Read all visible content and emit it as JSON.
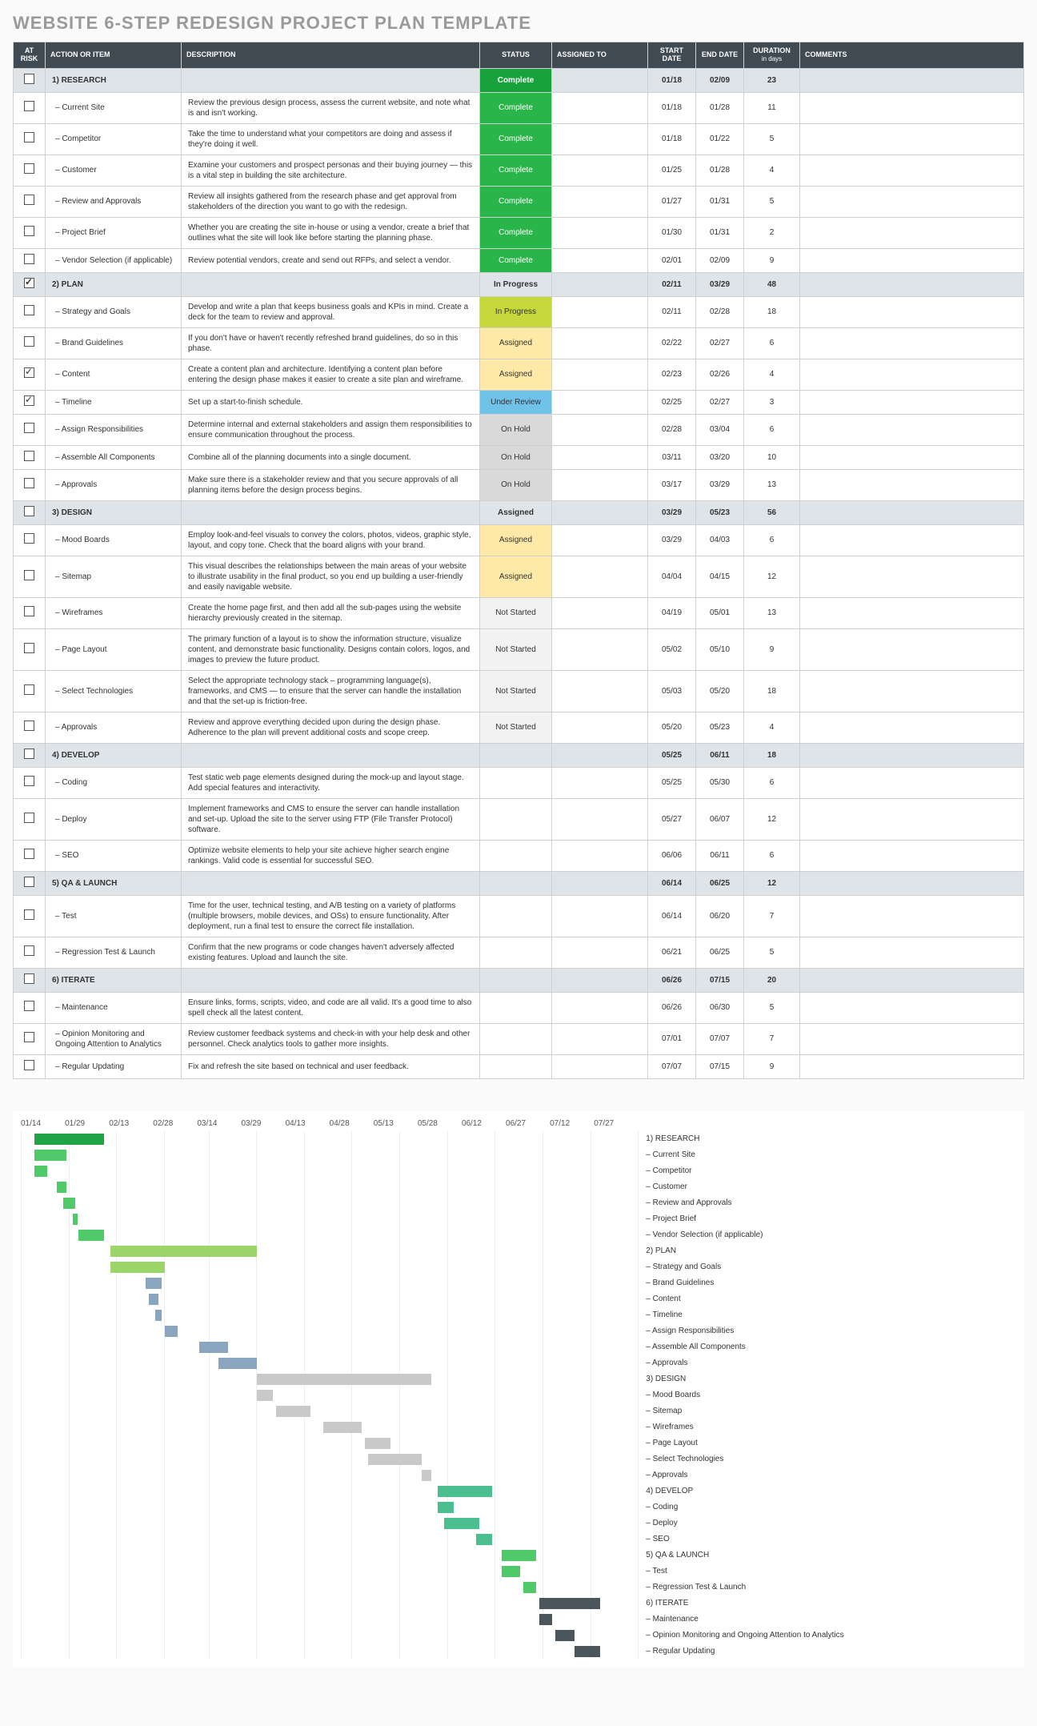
{
  "title": "WEBSITE 6-STEP REDESIGN PROJECT PLAN TEMPLATE",
  "headers": {
    "risk": "AT RISK",
    "action": "ACTION OR ITEM",
    "desc": "DESCRIPTION",
    "status": "STATUS",
    "assigned": "ASSIGNED TO",
    "start": "START DATE",
    "end": "END DATE",
    "duration": "DURATION",
    "duration_unit": "in days",
    "comments": "COMMENTS"
  },
  "rows": [
    {
      "phase": true,
      "chk": false,
      "action": "1) RESEARCH",
      "desc": "",
      "status": "Complete",
      "start": "01/18",
      "end": "02/09",
      "dur": "23"
    },
    {
      "chk": false,
      "action": "– Current Site",
      "desc": "Review the previous design process, assess the current website, and note what is and isn't working.",
      "status": "Complete",
      "start": "01/18",
      "end": "01/28",
      "dur": "11"
    },
    {
      "chk": false,
      "action": "– Competitor",
      "desc": "Take the time to understand what your competitors are doing and assess if they're doing it well.",
      "status": "Complete",
      "start": "01/18",
      "end": "01/22",
      "dur": "5"
    },
    {
      "chk": false,
      "action": "– Customer",
      "desc": "Examine your customers and prospect personas and their buying journey — this is a vital step in building the site architecture.",
      "status": "Complete",
      "start": "01/25",
      "end": "01/28",
      "dur": "4"
    },
    {
      "chk": false,
      "action": "– Review and Approvals",
      "desc": "Review all insights gathered from the research phase and get approval from stakeholders of the direction you want to go with the redesign.",
      "status": "Complete",
      "start": "01/27",
      "end": "01/31",
      "dur": "5"
    },
    {
      "chk": false,
      "action": "– Project Brief",
      "desc": "Whether you are creating the site in-house or using a vendor, create a brief that outlines what the site will look like before starting the planning phase.",
      "status": "Complete",
      "start": "01/30",
      "end": "01/31",
      "dur": "2"
    },
    {
      "chk": false,
      "action": "– Vendor Selection (if applicable)",
      "desc": "Review potential vendors, create and send out RFPs, and select a vendor.",
      "status": "Complete",
      "start": "02/01",
      "end": "02/09",
      "dur": "9"
    },
    {
      "phase": true,
      "chk": true,
      "action": "2) PLAN",
      "desc": "",
      "status": "In Progress",
      "start": "02/11",
      "end": "03/29",
      "dur": "48"
    },
    {
      "chk": false,
      "action": "– Strategy and Goals",
      "desc": "Develop and write a plan that keeps business goals and KPIs in mind. Create a deck for the team to review and approval.",
      "status": "In Progress",
      "start": "02/11",
      "end": "02/28",
      "dur": "18"
    },
    {
      "chk": false,
      "action": "– Brand Guidelines",
      "desc": "If you don't have or haven't recently refreshed brand guidelines, do so in this phase.",
      "status": "Assigned",
      "start": "02/22",
      "end": "02/27",
      "dur": "6"
    },
    {
      "chk": true,
      "action": "– Content",
      "desc": "Create a content plan and architecture. Identifying a content plan before entering the design phase makes it easier to create a site plan and wireframe.",
      "status": "Assigned",
      "start": "02/23",
      "end": "02/26",
      "dur": "4"
    },
    {
      "chk": true,
      "action": "– Timeline",
      "desc": "Set up a start-to-finish schedule.",
      "status": "Under Review",
      "start": "02/25",
      "end": "02/27",
      "dur": "3"
    },
    {
      "chk": false,
      "action": "– Assign Responsibilities",
      "desc": "Determine internal and external stakeholders and assign them responsibilities to ensure communication throughout the process.",
      "status": "On Hold",
      "start": "02/28",
      "end": "03/04",
      "dur": "6"
    },
    {
      "chk": false,
      "action": "– Assemble All Components",
      "desc": "Combine all of the planning documents into a single document.",
      "status": "On Hold",
      "start": "03/11",
      "end": "03/20",
      "dur": "10"
    },
    {
      "chk": false,
      "action": "– Approvals",
      "desc": "Make sure there is a stakeholder review and that you secure approvals of all planning items before the design process begins.",
      "status": "On Hold",
      "start": "03/17",
      "end": "03/29",
      "dur": "13"
    },
    {
      "phase": true,
      "chk": false,
      "action": "3) DESIGN",
      "desc": "",
      "status": "Assigned",
      "start": "03/29",
      "end": "05/23",
      "dur": "56"
    },
    {
      "chk": false,
      "action": "– Mood Boards",
      "desc": "Employ look-and-feel visuals to convey the colors, photos, videos, graphic style, layout, and copy tone. Check that the board aligns with your brand.",
      "status": "Assigned",
      "start": "03/29",
      "end": "04/03",
      "dur": "6"
    },
    {
      "chk": false,
      "action": "– Sitemap",
      "desc": "This visual describes the relationships between the main areas of your website to illustrate usability in the final product, so you end up building a user-friendly and easily navigable website.",
      "status": "Assigned",
      "start": "04/04",
      "end": "04/15",
      "dur": "12"
    },
    {
      "chk": false,
      "action": "– Wireframes",
      "desc": "Create the home page first, and then add all the sub-pages using the website hierarchy previously created in the sitemap.",
      "status": "Not Started",
      "start": "04/19",
      "end": "05/01",
      "dur": "13"
    },
    {
      "chk": false,
      "action": "– Page Layout",
      "desc": "The primary function of a layout is to show the information structure, visualize content, and demonstrate basic functionality. Designs contain colors, logos, and images to preview the future product.",
      "status": "Not Started",
      "start": "05/02",
      "end": "05/10",
      "dur": "9"
    },
    {
      "chk": false,
      "action": "– Select Technologies",
      "desc": "Select the appropriate technology stack – programming language(s), frameworks, and CMS — to ensure that the server can handle the installation and that the set-up is friction-free.",
      "status": "Not Started",
      "start": "05/03",
      "end": "05/20",
      "dur": "18"
    },
    {
      "chk": false,
      "action": "– Approvals",
      "desc": "Review and approve everything decided upon during the design phase. Adherence to the plan will prevent additional costs and scope creep.",
      "status": "Not Started",
      "start": "05/20",
      "end": "05/23",
      "dur": "4"
    },
    {
      "phase": true,
      "chk": false,
      "action": "4) DEVELOP",
      "desc": "",
      "status": "",
      "start": "05/25",
      "end": "06/11",
      "dur": "18"
    },
    {
      "chk": false,
      "action": "– Coding",
      "desc": "Test static web page elements designed during the mock-up and layout stage. Add special features and interactivity.",
      "status": "",
      "start": "05/25",
      "end": "05/30",
      "dur": "6"
    },
    {
      "chk": false,
      "action": "– Deploy",
      "desc": "Implement frameworks and CMS to ensure the server can handle installation and set-up. Upload the site to the server using FTP (File Transfer Protocol) software.",
      "status": "",
      "start": "05/27",
      "end": "06/07",
      "dur": "12"
    },
    {
      "chk": false,
      "action": "– SEO",
      "desc": "Optimize website elements to help your site achieve higher search engine rankings. Valid code is essential for successful SEO.",
      "status": "",
      "start": "06/06",
      "end": "06/11",
      "dur": "6"
    },
    {
      "phase": true,
      "chk": false,
      "action": "5) QA & LAUNCH",
      "desc": "",
      "status": "",
      "start": "06/14",
      "end": "06/25",
      "dur": "12"
    },
    {
      "chk": false,
      "action": "– Test",
      "desc": "Time for the user, technical testing, and A/B testing on a variety of platforms (multiple browsers, mobile devices, and OSs) to ensure functionality. After deployment, run a final test to ensure the correct file installation.",
      "status": "",
      "start": "06/14",
      "end": "06/20",
      "dur": "7"
    },
    {
      "chk": false,
      "action": "– Regression Test & Launch",
      "desc": "Confirm that the new programs or code changes haven't adversely affected existing features. Upload and launch the site.",
      "status": "",
      "start": "06/21",
      "end": "06/25",
      "dur": "5"
    },
    {
      "phase": true,
      "chk": false,
      "action": "6) ITERATE",
      "desc": "",
      "status": "",
      "start": "06/26",
      "end": "07/15",
      "dur": "20"
    },
    {
      "chk": false,
      "action": "– Maintenance",
      "desc": "Ensure links, forms, scripts, video, and code are all valid. It's a good time to also spell check all the latest content.",
      "status": "",
      "start": "06/26",
      "end": "06/30",
      "dur": "5"
    },
    {
      "chk": false,
      "action": "– Opinion Monitoring and Ongoing Attention to Analytics",
      "desc": "Review customer feedback systems and check-in with your help desk and other personnel. Check analytics tools to gather more insights.",
      "status": "",
      "start": "07/01",
      "end": "07/07",
      "dur": "7"
    },
    {
      "chk": false,
      "action": "– Regular Updating",
      "desc": "Fix and refresh the site based on technical and user feedback.",
      "status": "",
      "start": "07/07",
      "end": "07/15",
      "dur": "9"
    }
  ],
  "chart_data": {
    "type": "gantt",
    "axis": [
      "01/14",
      "01/29",
      "02/13",
      "02/28",
      "03/14",
      "03/29",
      "04/13",
      "04/28",
      "05/13",
      "05/28",
      "06/12",
      "06/27",
      "07/12",
      "07/27"
    ],
    "axis_start": "01/14",
    "axis_end": "07/27",
    "tasks": [
      {
        "label": "1) RESEARCH",
        "start": "01/18",
        "end": "02/09",
        "color": "bar-green-dark"
      },
      {
        "label": "– Current Site",
        "start": "01/18",
        "end": "01/28",
        "color": "bar-green"
      },
      {
        "label": "– Competitor",
        "start": "01/18",
        "end": "01/22",
        "color": "bar-green"
      },
      {
        "label": "– Customer",
        "start": "01/25",
        "end": "01/28",
        "color": "bar-green"
      },
      {
        "label": "– Review and Approvals",
        "start": "01/27",
        "end": "01/31",
        "color": "bar-green"
      },
      {
        "label": "– Project Brief",
        "start": "01/30",
        "end": "01/31",
        "color": "bar-green"
      },
      {
        "label": "– Vendor Selection (if applicable)",
        "start": "02/01",
        "end": "02/09",
        "color": "bar-green"
      },
      {
        "label": "2) PLAN",
        "start": "02/11",
        "end": "03/29",
        "color": "bar-green-lt"
      },
      {
        "label": "– Strategy and Goals",
        "start": "02/11",
        "end": "02/28",
        "color": "bar-green-lt"
      },
      {
        "label": "– Brand Guidelines",
        "start": "02/22",
        "end": "02/27",
        "color": "bar-blue"
      },
      {
        "label": "– Content",
        "start": "02/23",
        "end": "02/26",
        "color": "bar-blue"
      },
      {
        "label": "– Timeline",
        "start": "02/25",
        "end": "02/27",
        "color": "bar-blue"
      },
      {
        "label": "– Assign Responsibilities",
        "start": "02/28",
        "end": "03/04",
        "color": "bar-blue"
      },
      {
        "label": "– Assemble All Components",
        "start": "03/11",
        "end": "03/20",
        "color": "bar-blue"
      },
      {
        "label": "– Approvals",
        "start": "03/17",
        "end": "03/29",
        "color": "bar-blue"
      },
      {
        "label": "3) DESIGN",
        "start": "03/29",
        "end": "05/23",
        "color": "bar-grey"
      },
      {
        "label": "– Mood Boards",
        "start": "03/29",
        "end": "04/03",
        "color": "bar-grey"
      },
      {
        "label": "– Sitemap",
        "start": "04/04",
        "end": "04/15",
        "color": "bar-grey"
      },
      {
        "label": "– Wireframes",
        "start": "04/19",
        "end": "05/01",
        "color": "bar-grey"
      },
      {
        "label": "– Page Layout",
        "start": "05/02",
        "end": "05/10",
        "color": "bar-grey"
      },
      {
        "label": "– Select Technologies",
        "start": "05/03",
        "end": "05/20",
        "color": "bar-grey"
      },
      {
        "label": "– Approvals",
        "start": "05/20",
        "end": "05/23",
        "color": "bar-grey"
      },
      {
        "label": "4) DEVELOP",
        "start": "05/25",
        "end": "06/11",
        "color": "bar-teal"
      },
      {
        "label": "– Coding",
        "start": "05/25",
        "end": "05/30",
        "color": "bar-teal"
      },
      {
        "label": "– Deploy",
        "start": "05/27",
        "end": "06/07",
        "color": "bar-teal"
      },
      {
        "label": "– SEO",
        "start": "06/06",
        "end": "06/11",
        "color": "bar-teal"
      },
      {
        "label": "5) QA & LAUNCH",
        "start": "06/14",
        "end": "06/25",
        "color": "bar-green"
      },
      {
        "label": "– Test",
        "start": "06/14",
        "end": "06/20",
        "color": "bar-green"
      },
      {
        "label": "– Regression Test & Launch",
        "start": "06/21",
        "end": "06/25",
        "color": "bar-green"
      },
      {
        "label": "6) ITERATE",
        "start": "06/26",
        "end": "07/15",
        "color": "bar-dark"
      },
      {
        "label": "– Maintenance",
        "start": "06/26",
        "end": "06/30",
        "color": "bar-dark"
      },
      {
        "label": "– Opinion Monitoring and Ongoing Attention to Analytics",
        "start": "07/01",
        "end": "07/07",
        "color": "bar-dark"
      },
      {
        "label": "– Regular Updating",
        "start": "07/07",
        "end": "07/15",
        "color": "bar-dark"
      }
    ]
  }
}
